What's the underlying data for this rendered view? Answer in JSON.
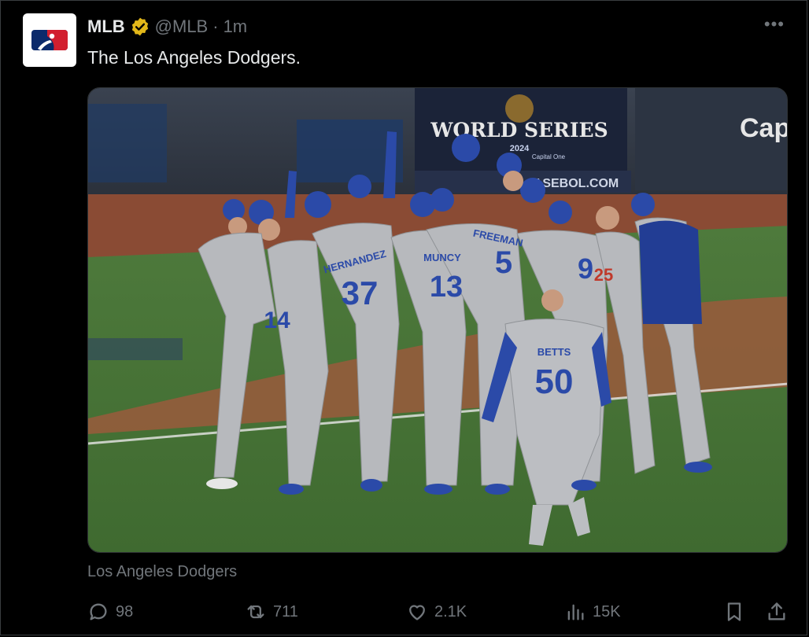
{
  "tweet": {
    "author_name": "MLB",
    "handle": "@MLB",
    "separator": "·",
    "time": "1m",
    "text": "The Los Angeles Dodgers.",
    "more": "•••",
    "avatar_icon": "mlb-logo-icon",
    "verified_icon": "verified-badge-icon",
    "verified_color": "#e2b719"
  },
  "media": {
    "caption": "Los Angeles Dodgers",
    "banner_text": "WORLD SERIES",
    "banner_year": "2024",
    "banner_sub": "Capital One",
    "fence_text": "ASEBOL.COM",
    "ad_text": "Cap",
    "players": [
      {
        "name": "HERNANDEZ",
        "number": "37"
      },
      {
        "name": "MUNCY",
        "number": "13"
      },
      {
        "name": "FREEMAN",
        "number": "5"
      },
      {
        "name": "BETTS",
        "number": "50"
      },
      {
        "name": "",
        "number": "9"
      },
      {
        "name": "",
        "number": "14"
      },
      {
        "name": "",
        "number": "25"
      }
    ],
    "team_blue": "#2b4aa8",
    "uniform_gray": "#b7b9bd"
  },
  "actions": {
    "replies": "98",
    "reposts": "711",
    "likes": "2.1K",
    "views": "15K"
  }
}
